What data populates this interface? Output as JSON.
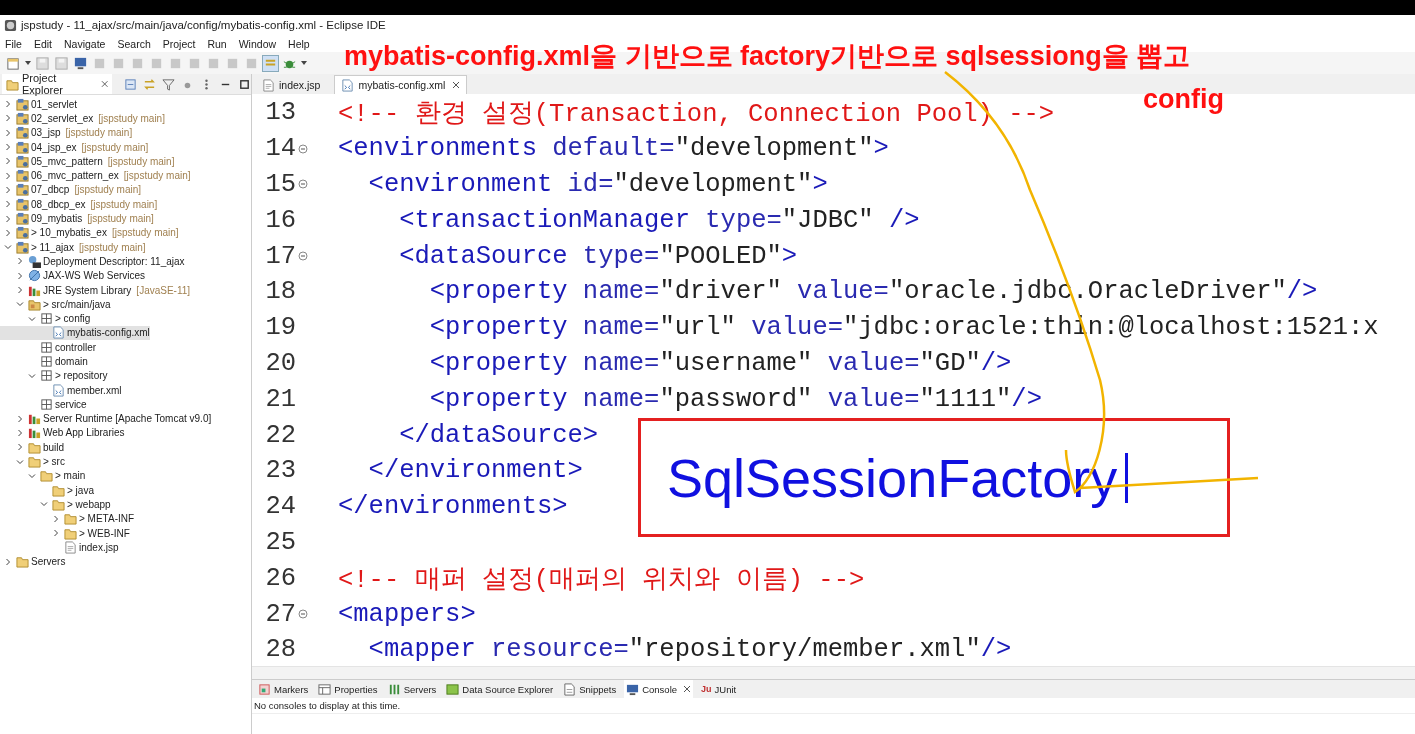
{
  "window": {
    "title": "jspstudy - 11_ajax/src/main/java/config/mybatis-config.xml - Eclipse IDE"
  },
  "menu": [
    "File",
    "Edit",
    "Navigate",
    "Search",
    "Project",
    "Run",
    "Window",
    "Help"
  ],
  "project_explorer": {
    "title": "Project Explorer",
    "items": [
      {
        "label": "01_servlet",
        "kind": "project",
        "expanded": false,
        "selected": false
      },
      {
        "label": "02_servlet_ex",
        "decoration": "[jspstudy main]",
        "kind": "project",
        "expanded": false,
        "selected": false
      },
      {
        "label": "03_jsp",
        "decoration": "[jspstudy main]",
        "kind": "project",
        "expanded": false,
        "selected": false
      },
      {
        "label": "04_jsp_ex",
        "decoration": "[jspstudy main]",
        "kind": "project",
        "expanded": false,
        "selected": false
      },
      {
        "label": "05_mvc_pattern",
        "decoration": "[jspstudy main]",
        "kind": "project",
        "expanded": false,
        "selected": false
      },
      {
        "label": "06_mvc_pattern_ex",
        "decoration": "[jspstudy main]",
        "kind": "project",
        "expanded": false,
        "selected": false
      },
      {
        "label": "07_dbcp",
        "decoration": "[jspstudy main]",
        "kind": "project",
        "expanded": false,
        "selected": false
      },
      {
        "label": "08_dbcp_ex",
        "decoration": "[jspstudy main]",
        "kind": "project",
        "expanded": false,
        "selected": false
      },
      {
        "label": "09_mybatis",
        "decoration": "[jspstudy main]",
        "kind": "project",
        "expanded": false,
        "selected": false
      },
      {
        "label": "> 10_mybatis_ex",
        "decoration": "[jspstudy main]",
        "kind": "project",
        "expanded": false,
        "selected": false
      },
      {
        "label": "> 11_ajax",
        "decoration": "[jspstudy main]",
        "kind": "project",
        "expanded": true,
        "selected": false,
        "children": [
          {
            "label": "Deployment Descriptor: 11_ajax",
            "kind": "descriptor",
            "expanded": false,
            "selected": false
          },
          {
            "label": "JAX-WS Web Services",
            "kind": "webservices",
            "expanded": false,
            "selected": false
          },
          {
            "label": "JRE System Library",
            "decoration": "[JavaSE-11]",
            "kind": "library",
            "expanded": false,
            "selected": false
          },
          {
            "label": "> src/main/java",
            "kind": "srcfolder",
            "expanded": true,
            "selected": false,
            "children": [
              {
                "label": "> config",
                "kind": "package",
                "expanded": true,
                "selected": false,
                "children": [
                  {
                    "label": "mybatis-config.xml",
                    "kind": "xml",
                    "selected": true
                  }
                ]
              },
              {
                "label": "controller",
                "kind": "package",
                "selected": false
              },
              {
                "label": "domain",
                "kind": "package",
                "selected": false
              },
              {
                "label": "> repository",
                "kind": "package",
                "expanded": true,
                "selected": false,
                "children": [
                  {
                    "label": "member.xml",
                    "kind": "xml",
                    "selected": false
                  }
                ]
              },
              {
                "label": "service",
                "kind": "package",
                "selected": false
              }
            ]
          },
          {
            "label": "Server Runtime [Apache Tomcat v9.0]",
            "kind": "library",
            "expanded": false,
            "selected": false
          },
          {
            "label": "Web App Libraries",
            "kind": "library",
            "expanded": false,
            "selected": false
          },
          {
            "label": "build",
            "kind": "folder",
            "expanded": false,
            "selected": false
          },
          {
            "label": "> src",
            "kind": "folder",
            "expanded": true,
            "selected": false,
            "children": [
              {
                "label": "> main",
                "kind": "folder",
                "expanded": true,
                "selected": false,
                "children": [
                  {
                    "label": "> java",
                    "kind": "folder",
                    "selected": false
                  },
                  {
                    "label": "> webapp",
                    "kind": "folder",
                    "expanded": true,
                    "selected": false,
                    "children": [
                      {
                        "label": "> META-INF",
                        "kind": "folder",
                        "expanded": false,
                        "selected": false
                      },
                      {
                        "label": "> WEB-INF",
                        "kind": "folder",
                        "expanded": false,
                        "selected": false
                      },
                      {
                        "label": "index.jsp",
                        "kind": "jsp",
                        "selected": false
                      }
                    ]
                  }
                ]
              }
            ]
          }
        ]
      },
      {
        "label": "Servers",
        "kind": "folder",
        "expanded": false,
        "selected": false
      }
    ]
  },
  "editor_tabs": [
    {
      "label": "index.jsp",
      "kind": "jsp",
      "selected": false
    },
    {
      "label": "mybatis-config.xml",
      "kind": "xml",
      "selected": true
    }
  ],
  "code_lines": [
    {
      "number": "13",
      "foldable": false,
      "tokens": [
        {
          "kind": "comment",
          "text": "<!-- 환경 설정(Transaction, Connection Pool) -->"
        }
      ]
    },
    {
      "number": "14",
      "foldable": true,
      "tokens": [
        {
          "kind": "tag",
          "text": "<environments"
        },
        {
          "kind": "attr",
          "text": " default="
        },
        {
          "kind": "value",
          "text": "\"development\""
        },
        {
          "kind": "tag",
          "text": ">"
        }
      ]
    },
    {
      "number": "15",
      "foldable": true,
      "tokens": [
        {
          "kind": "tag",
          "text": "  <environment"
        },
        {
          "kind": "attr",
          "text": " id="
        },
        {
          "kind": "value",
          "text": "\"development\""
        },
        {
          "kind": "tag",
          "text": ">"
        }
      ]
    },
    {
      "number": "16",
      "foldable": false,
      "tokens": [
        {
          "kind": "tag",
          "text": "    <transactionManager"
        },
        {
          "kind": "attr",
          "text": " type="
        },
        {
          "kind": "value",
          "text": "\"JDBC\""
        },
        {
          "kind": "tag",
          "text": " />"
        }
      ]
    },
    {
      "number": "17",
      "foldable": true,
      "tokens": [
        {
          "kind": "tag",
          "text": "    <dataSource"
        },
        {
          "kind": "attr",
          "text": " type="
        },
        {
          "kind": "value",
          "text": "\"POOLED\""
        },
        {
          "kind": "tag",
          "text": ">"
        }
      ]
    },
    {
      "number": "18",
      "foldable": false,
      "tokens": [
        {
          "kind": "tag",
          "text": "      <property"
        },
        {
          "kind": "attr",
          "text": " name="
        },
        {
          "kind": "value",
          "text": "\"driver\""
        },
        {
          "kind": "attr",
          "text": " value="
        },
        {
          "kind": "value",
          "text": "\"oracle.jdbc.OracleDriver\""
        },
        {
          "kind": "tag",
          "text": "/>"
        }
      ]
    },
    {
      "number": "19",
      "foldable": false,
      "tokens": [
        {
          "kind": "tag",
          "text": "      <property"
        },
        {
          "kind": "attr",
          "text": " name="
        },
        {
          "kind": "value",
          "text": "\"url\""
        },
        {
          "kind": "attr",
          "text": " value="
        },
        {
          "kind": "value",
          "text": "\"jdbc:oracle:thin:@localhost:1521:x"
        }
      ]
    },
    {
      "number": "20",
      "foldable": false,
      "tokens": [
        {
          "kind": "tag",
          "text": "      <property"
        },
        {
          "kind": "attr",
          "text": " name="
        },
        {
          "kind": "value",
          "text": "\"username\""
        },
        {
          "kind": "attr",
          "text": " value="
        },
        {
          "kind": "value",
          "text": "\"GD\""
        },
        {
          "kind": "tag",
          "text": "/>"
        }
      ]
    },
    {
      "number": "21",
      "foldable": false,
      "tokens": [
        {
          "kind": "tag",
          "text": "      <property"
        },
        {
          "kind": "attr",
          "text": " name="
        },
        {
          "kind": "value",
          "text": "\"password\""
        },
        {
          "kind": "attr",
          "text": " value="
        },
        {
          "kind": "value",
          "text": "\"1111\""
        },
        {
          "kind": "tag",
          "text": "/>"
        }
      ]
    },
    {
      "number": "22",
      "foldable": false,
      "tokens": [
        {
          "kind": "tag",
          "text": "    </dataSource>"
        }
      ]
    },
    {
      "number": "23",
      "foldable": false,
      "tokens": [
        {
          "kind": "tag",
          "text": "  </environment>"
        }
      ]
    },
    {
      "number": "24",
      "foldable": false,
      "tokens": [
        {
          "kind": "tag",
          "text": "</environments>"
        }
      ]
    },
    {
      "number": "25",
      "foldable": false
    },
    {
      "number": "26",
      "foldable": false,
      "tokens": [
        {
          "kind": "comment",
          "text": "<!-- 매퍼 설정(매퍼의 위치와 이름) -->"
        }
      ]
    },
    {
      "number": "27",
      "foldable": true,
      "tokens": [
        {
          "kind": "tag",
          "text": "<mappers>"
        }
      ]
    },
    {
      "number": "28",
      "foldable": false,
      "tokens": [
        {
          "kind": "tag",
          "text": "  <mapper"
        },
        {
          "kind": "attr",
          "text": " resource="
        },
        {
          "kind": "value",
          "text": "\"repository/member.xml\""
        },
        {
          "kind": "tag",
          "text": "/>"
        }
      ]
    }
  ],
  "bottom_tabs": [
    {
      "label": "Markers",
      "kind": "markers",
      "selected": false
    },
    {
      "label": "Properties",
      "kind": "properties",
      "selected": false
    },
    {
      "label": "Servers",
      "kind": "servers",
      "selected": false
    },
    {
      "label": "Data Source Explorer",
      "kind": "datasource",
      "selected": false
    },
    {
      "label": "Snippets",
      "kind": "snippets",
      "selected": false
    },
    {
      "label": "Console",
      "kind": "console",
      "selected": true
    },
    {
      "label": "JUnit",
      "kind": "junit",
      "badge": "Ju",
      "selected": false
    }
  ],
  "console": {
    "message": "No consoles to display at this time."
  },
  "annotations": {
    "notes": [
      "mybatis-config.xml을 기반으로 factory기반으로 sqlsessiong을 뽑고",
      "config"
    ],
    "box_text": "SqlSessionFactory"
  }
}
